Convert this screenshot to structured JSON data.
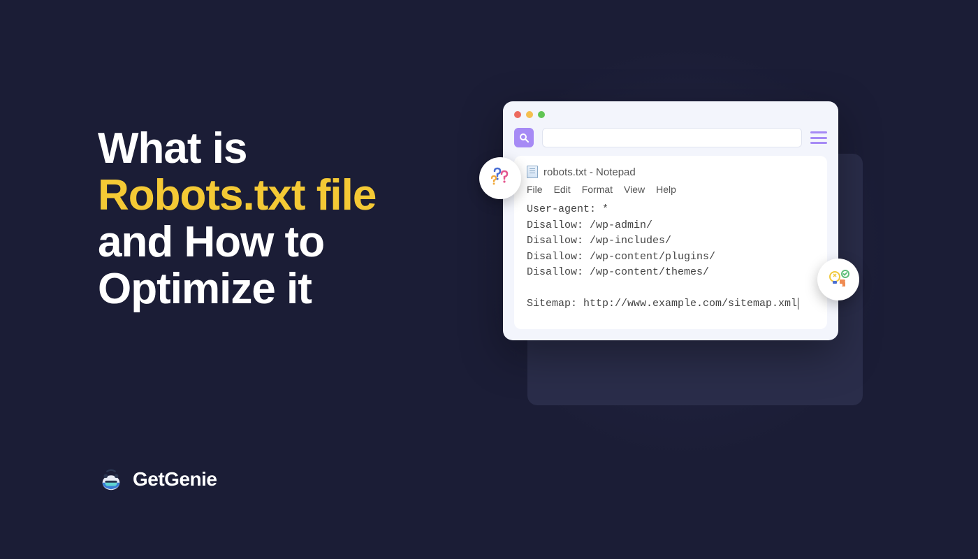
{
  "headline": {
    "line1": "What is",
    "highlight": "Robots.txt file",
    "line3": "and How to Optimize it"
  },
  "logo": {
    "text": "GetGenie"
  },
  "notepad": {
    "title": "robots.txt - Notepad",
    "menu": [
      "File",
      "Edit",
      "Format",
      "View",
      "Help"
    ],
    "lines": [
      "User-agent: *",
      "Disallow: /wp-admin/",
      "Disallow: /wp-includes/",
      "Disallow: /wp-content/plugins/",
      "Disallow: /wp-content/themes/",
      "",
      "Sitemap: http://www.example.com/sitemap.xml"
    ]
  }
}
